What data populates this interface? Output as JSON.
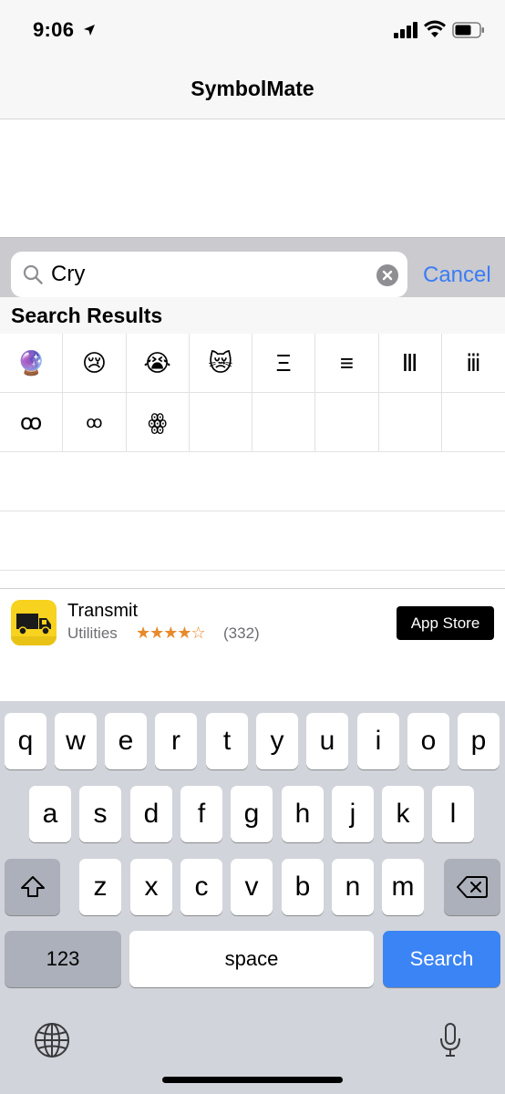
{
  "status": {
    "time": "9:06"
  },
  "nav": {
    "title": "SymbolMate"
  },
  "search": {
    "value": "Cry",
    "cancel_label": "Cancel"
  },
  "results": {
    "title": "Search Results",
    "row1": [
      "🔮",
      "😢",
      "😭",
      "😿",
      "Ξ",
      "≡",
      "Ⅲ",
      "ⅲ"
    ],
    "row2": [
      "ꝏ",
      "ꝏ",
      "ꙮ",
      "",
      "",
      "",
      "",
      ""
    ]
  },
  "ad": {
    "title": "Transmit",
    "category": "Utilities",
    "stars": "★★★★☆",
    "rating_count": "(332)",
    "button_label": "App Store",
    "icon": "truck-icon"
  },
  "keyboard": {
    "row1": [
      "q",
      "w",
      "e",
      "r",
      "t",
      "y",
      "u",
      "i",
      "o",
      "p"
    ],
    "row2": [
      "a",
      "s",
      "d",
      "f",
      "g",
      "h",
      "j",
      "k",
      "l"
    ],
    "row3": [
      "z",
      "x",
      "c",
      "v",
      "b",
      "n",
      "m"
    ],
    "numbers_label": "123",
    "space_label": "space",
    "search_label": "Search"
  },
  "colors": {
    "accent": "#3b7cf4",
    "search_key": "#3a84f5",
    "star": "#e8892b",
    "ad_icon": "#f7d21f"
  }
}
